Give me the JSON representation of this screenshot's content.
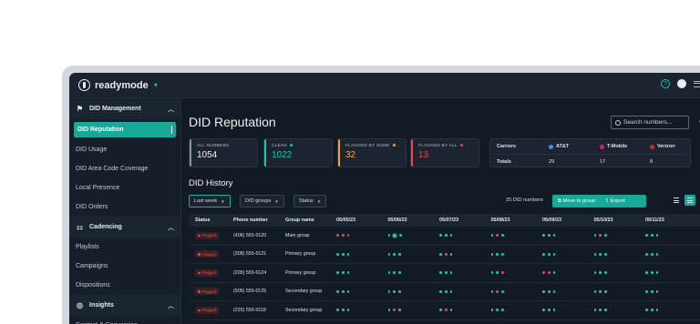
{
  "brand": "readymode",
  "colors": {
    "accent": "#17a897",
    "danger": "#e5484d",
    "warning": "#f5a524",
    "clean": "#1dc6b0",
    "dot_neutral": "#4a5866"
  },
  "sidebar": {
    "sections": [
      {
        "title": "DID Management",
        "icon": "flag-icon",
        "items": [
          {
            "label": "DID Reputation",
            "active": true
          },
          {
            "label": "DID Usage"
          },
          {
            "label": "DID Area Code Coverage"
          },
          {
            "label": "Local Presence"
          },
          {
            "label": "DID Orders"
          }
        ]
      },
      {
        "title": "Cadencing",
        "icon": "flow-icon",
        "items": [
          {
            "label": "Playlists"
          },
          {
            "label": "Campaigns"
          },
          {
            "label": "Dispositions"
          }
        ]
      },
      {
        "title": "Insights",
        "icon": "bulb-icon",
        "items": [
          {
            "label": "Contact & Conversion"
          }
        ]
      }
    ]
  },
  "main": {
    "title": "DID Reputation",
    "search_placeholder": "Search numbers...",
    "stats": [
      {
        "label": "ALL NUMBERS",
        "value": "1054",
        "color": "#8c96a1",
        "value_color": "#eef2f6"
      },
      {
        "label": "CLEAN",
        "value": "1022",
        "color": "#1dc6b0",
        "value_color": "#1dc6b0"
      },
      {
        "label": "FLAGGED BY SOME",
        "value": "32",
        "color": "#f5a524",
        "value_color": "#f5a524"
      },
      {
        "label": "FLAGGED BY ALL",
        "value": "13",
        "color": "#e5484d",
        "value_color": "#e5484d"
      }
    ],
    "carriers": {
      "header": "Carriers",
      "row_label": "Totals",
      "items": [
        {
          "name": "AT&T",
          "total": "29",
          "color": "#2f8ef5"
        },
        {
          "name": "T-Mobile",
          "total": "17",
          "color": "#d0207e"
        },
        {
          "name": "Verizon",
          "total": "8",
          "color": "#d4252f"
        }
      ]
    },
    "history": {
      "title": "DID History",
      "filters": [
        "Last week",
        "DID groups",
        "Status"
      ],
      "count_text": "25 DID numbers",
      "move_label": "Move to group",
      "export_label": "Export",
      "columns": [
        "Status",
        "Phone number",
        "Group name",
        "05/05/23",
        "05/06/23",
        "05/07/23",
        "05/08/23",
        "05/09/23",
        "05/10/23",
        "05/11/23"
      ],
      "rows": [
        {
          "status": "Flagged",
          "phone": "(406) 555-0120",
          "group": "Main group",
          "dots": [
            "rrr",
            "gtg",
            "ggg",
            "grg",
            "ggg",
            "grg",
            "ggg"
          ]
        },
        {
          "status": "Flagged",
          "phone": "(308) 555-0121",
          "group": "Primary group",
          "dots": [
            "ggg",
            "ggg",
            "grg",
            "ggg",
            "ggg",
            "ggg",
            "ggg"
          ]
        },
        {
          "status": "Flagged",
          "phone": "(200) 555-0124",
          "group": "Primary group",
          "dots": [
            "ggg",
            "ggg",
            "ggg",
            "ggr",
            "rrg",
            "ggg",
            "ggg"
          ]
        },
        {
          "status": "Flagged",
          "phone": "(505) 555-0125",
          "group": "Secondary group",
          "dots": [
            "ggg",
            "ggg",
            "ggg",
            "grg",
            "ggg",
            "ggg",
            "ggg"
          ]
        },
        {
          "status": "Flagged",
          "phone": "(225) 555-0118",
          "group": "Secondary group",
          "dots": [
            "ggg",
            "grg",
            "grg",
            "ggg",
            "ggg",
            "ggg",
            "ggg"
          ]
        }
      ]
    }
  }
}
